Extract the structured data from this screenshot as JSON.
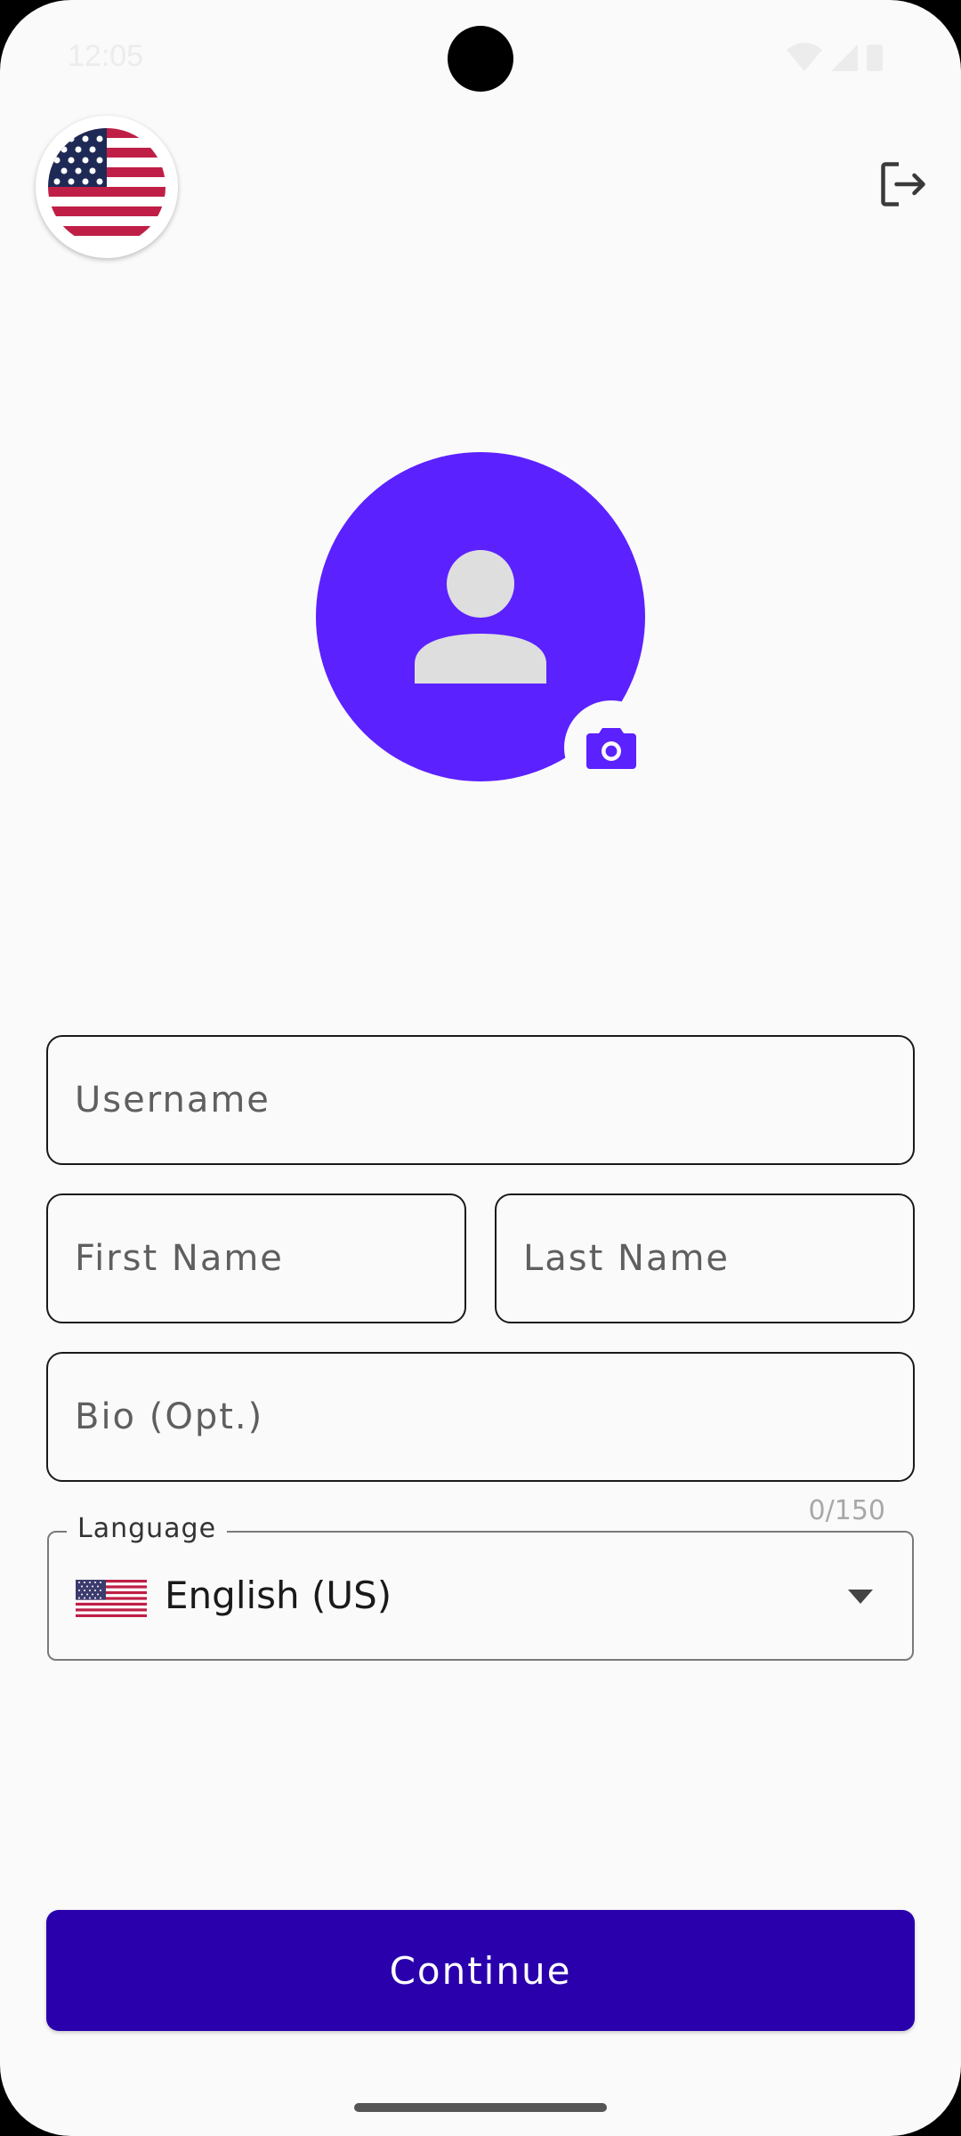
{
  "status_bar": {
    "time": "12:05",
    "icons": [
      "wifi-icon",
      "signal-icon",
      "battery-icon"
    ]
  },
  "header": {
    "country_icon": "us-flag-icon",
    "logout_icon": "logout-icon"
  },
  "profile": {
    "avatar_icon": "person-icon",
    "camera_icon": "camera-icon"
  },
  "form": {
    "username_placeholder": "Username",
    "first_name_placeholder": "First Name",
    "last_name_placeholder": "Last Name",
    "bio_placeholder": "Bio (Opt.)",
    "bio_counter": "0/150",
    "language_label": "Language",
    "language_value": "English (US)",
    "language_flag_icon": "us-flag-icon"
  },
  "actions": {
    "continue_label": "Continue"
  },
  "colors": {
    "accent": "#5b21ff",
    "primary_button": "#2a00ad",
    "background": "#fafafa"
  }
}
